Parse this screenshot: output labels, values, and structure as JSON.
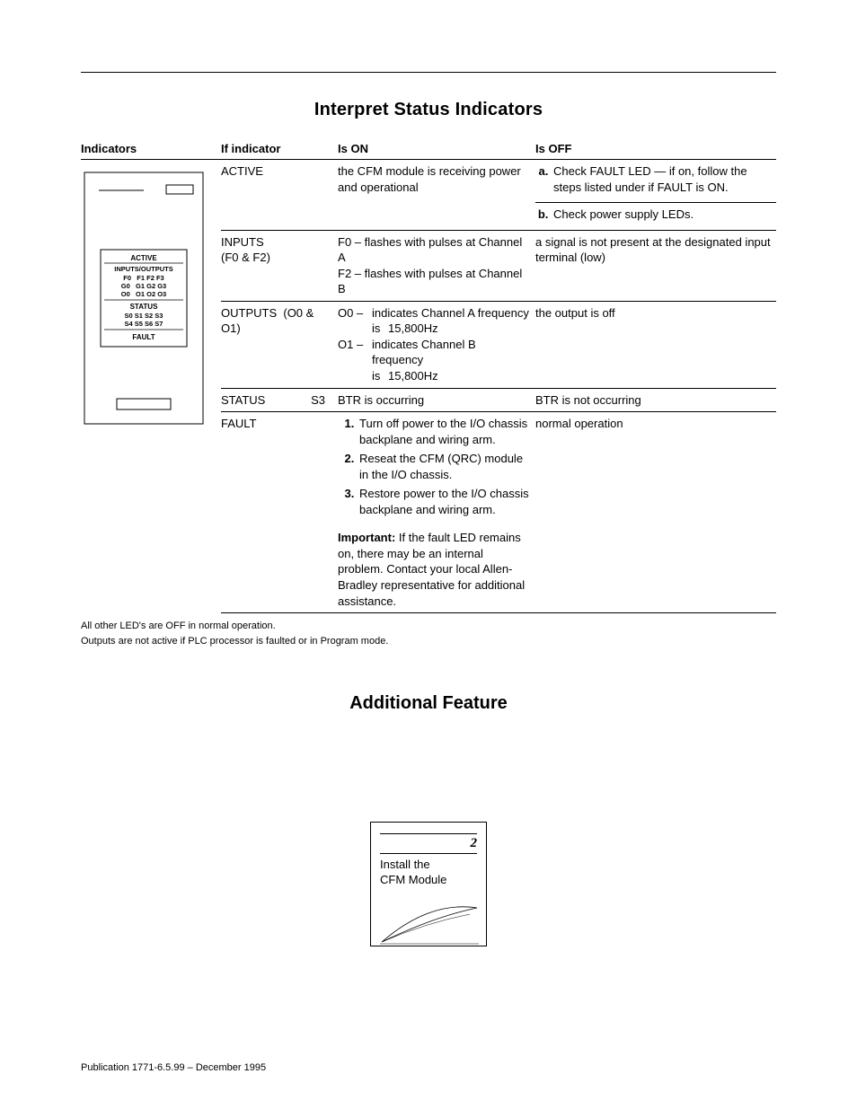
{
  "heading1": "Interpret Status Indicators",
  "heading2": "Additional Feature",
  "headers": {
    "c1": "Indicators",
    "c2": "If indicator",
    "c3": "Is ON",
    "c4": "Is OFF"
  },
  "diagram": {
    "active": "ACTIVE",
    "io": "INPUTS/OUTPUTS",
    "frow": "F0   F1 F2 F3",
    "grow": "G0   G1 G2 G3",
    "orow": "O0   O1 O2 O3",
    "status": "STATUS",
    "srow1": "S0 S1 S2 S3",
    "srow2": "S4 S5 S6 S7",
    "fault": "FAULT"
  },
  "rows": {
    "active": {
      "name": "ACTIVE",
      "on": "the CFM module is receiving power and operational",
      "off_a": "Check FAULT LED — if on, follow the steps listed under if FAULT is ON.",
      "off_b": "Check power supply LEDs."
    },
    "inputs": {
      "name": "INPUTS",
      "name2": "(F0 & F2)",
      "on1": "F0 – flashes with pulses at Channel A",
      "on2": "F2 – flashes with pulses at Channel B",
      "off": "a signal is not present at the designated input terminal (low)"
    },
    "outputs": {
      "name": "OUTPUTS",
      "name2": "(O0 & O1)",
      "o0tag": "O0 –",
      "o0a": "indicates Channel A frequency",
      "o0is": "is",
      "o0b": "15,800Hz",
      "o1tag": "O1 –",
      "o1a": "indicates Channel B frequency",
      "o1is": "is",
      "o1b": "15,800Hz",
      "off": "the output is off"
    },
    "status": {
      "name": "STATUS",
      "name2": "S3",
      "on": "BTR is occurring",
      "off": "BTR is not occurring"
    },
    "fault": {
      "name": "FAULT",
      "step1": "Turn off power to the I/O chassis backplane and wiring arm.",
      "step2": "Reseat the CFM (QRC) module in the I/O chassis.",
      "step3": "Restore power to the I/O chassis backplane and wiring arm.",
      "imp_label": "Important:",
      "imp_text": "  If the fault LED remains on, there may be an internal problem. Contact your local Allen-Bradley representative for additional assistance.",
      "off": "normal operation"
    }
  },
  "footnote1": "All other LED's are OFF in normal operation.",
  "footnote2": "Outputs are not active if PLC processor is faulted or in Program mode.",
  "install": {
    "num": "2",
    "line1": "Install the",
    "line2": "CFM Module"
  },
  "publication": "Publication 1771-6.5.99 – December 1995"
}
